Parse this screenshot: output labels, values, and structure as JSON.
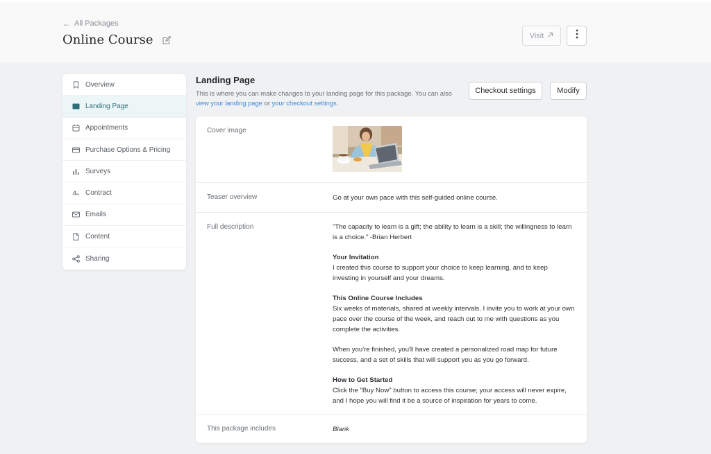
{
  "header": {
    "back_label": "All Packages",
    "title": "Online Course",
    "visit_label": "Visit"
  },
  "sidebar": {
    "items": [
      {
        "label": "Overview",
        "icon": "bookmark-icon"
      },
      {
        "label": "Landing Page",
        "icon": "landing-page-icon",
        "active": true
      },
      {
        "label": "Appointments",
        "icon": "calendar-icon"
      },
      {
        "label": "Purchase Options & Pricing",
        "icon": "credit-card-icon"
      },
      {
        "label": "Surveys",
        "icon": "bar-chart-icon"
      },
      {
        "label": "Contract",
        "icon": "signature-icon"
      },
      {
        "label": "Emails",
        "icon": "envelope-icon"
      },
      {
        "label": "Content",
        "icon": "file-icon"
      },
      {
        "label": "Sharing",
        "icon": "share-icon"
      }
    ]
  },
  "section": {
    "title": "Landing Page",
    "desc_text": "This is where you can make changes to your landing page for this package. You can also",
    "link1": "view your landing page",
    "or_text": "or",
    "link2": "your checkout settings.",
    "checkout_label": "Checkout settings",
    "modify_label": "Modify"
  },
  "card": {
    "cover_label": "Cover image",
    "teaser_label": "Teaser overview",
    "teaser_value": "Go at your own pace with this self-guided online course.",
    "full_label": "Full description",
    "full": {
      "quote": "“The capacity to learn is a gift; the ability to learn is a skill; the willingness to learn is a choice.” -Brian Herbert",
      "h1": "Your Invitation",
      "p1": "I created this course to support your choice to keep learning, and to keep investing in yourself and your dreams.",
      "h2": "This Online Course Includes",
      "p2": "Six weeks of materials, shared at weekly intervals. I invite you to work at your own pace over the course of the week, and reach out to me with questions as you complete the activities.",
      "p3": "When you're finished, you'll have created a personalized road map for future success, and a set of skills that will support you as you go forward.",
      "h3": "How to Get Started",
      "p4": "Click the \"Buy Now\" button to access this course; your access will never expire, and I hope you will find it be a source of inspiration for years to come."
    },
    "includes_label": "This package includes",
    "includes_value": "Blank"
  },
  "colors": {
    "accent_link": "#3d8bd6",
    "active_bg": "#ecf6f7",
    "active_text": "#2f6e7a"
  }
}
